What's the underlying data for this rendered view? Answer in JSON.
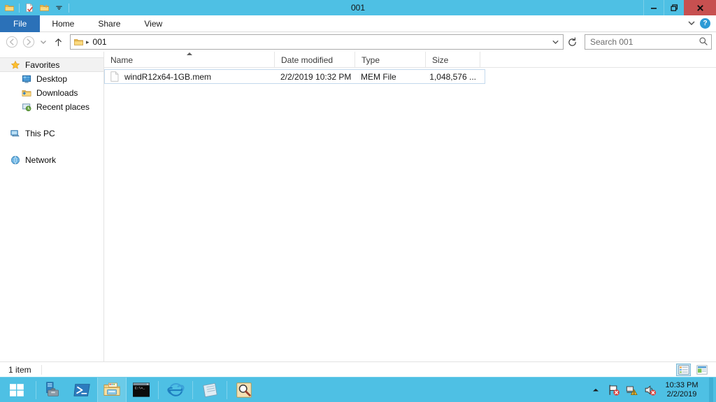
{
  "window": {
    "title": "001",
    "quick_access": [
      {
        "name": "system-menu-folder-icon",
        "label": "001"
      },
      {
        "name": "properties-icon",
        "label": "Properties"
      },
      {
        "name": "new-folder-icon",
        "label": "New folder"
      },
      {
        "name": "customize-qat-chevron-icon",
        "label": "Customize Quick Access Toolbar"
      }
    ],
    "controls": {
      "minimize": "Minimize",
      "restore": "Restore Down",
      "close": "Close"
    }
  },
  "ribbon": {
    "tabs": [
      {
        "label": "File",
        "active": true
      },
      {
        "label": "Home",
        "active": false
      },
      {
        "label": "Share",
        "active": false
      },
      {
        "label": "View",
        "active": false
      }
    ],
    "expand_label": "Expand the Ribbon",
    "help_label": "?"
  },
  "navbar": {
    "back_label": "Back",
    "forward_label": "Forward",
    "recent_label": "Recent locations",
    "up_label": "Up",
    "address": {
      "folder_icon": "folder-icon",
      "crumb": "001",
      "separator": "▸",
      "dropdown_label": "Previous locations",
      "refresh_label": "Refresh \"001\" (F5)"
    },
    "search": {
      "placeholder": "Search 001",
      "icon": "search-icon"
    }
  },
  "navpane": {
    "items": [
      {
        "label": "Favorites",
        "icon": "star-icon",
        "level": 0,
        "selected": true
      },
      {
        "label": "Desktop",
        "icon": "desktop-icon",
        "level": 1,
        "selected": false
      },
      {
        "label": "Downloads",
        "icon": "downloads-icon",
        "level": 1,
        "selected": false
      },
      {
        "label": "Recent places",
        "icon": "recent-places-icon",
        "level": 1,
        "selected": false
      },
      {
        "label": "This PC",
        "icon": "this-pc-icon",
        "level": 0,
        "selected": false
      },
      {
        "label": "Network",
        "icon": "network-icon",
        "level": 0,
        "selected": false
      }
    ]
  },
  "filelist": {
    "columns": [
      {
        "label": "Name",
        "sorted": true,
        "sort_direction": "asc"
      },
      {
        "label": "Date modified",
        "sorted": false
      },
      {
        "label": "Type",
        "sorted": false
      },
      {
        "label": "Size",
        "sorted": false
      }
    ],
    "rows": [
      {
        "icon": "generic-file-icon",
        "name": "windR12x64-1GB.mem",
        "date_modified": "2/2/2019 10:32 PM",
        "type": "MEM File",
        "size": "1,048,576 ..."
      }
    ]
  },
  "statusbar": {
    "item_count": "1 item",
    "views": [
      {
        "name": "details-view-button",
        "label": "Details",
        "active": true
      },
      {
        "name": "large-icons-view-button",
        "label": "Large icons",
        "active": false
      }
    ]
  },
  "taskbar": {
    "start_label": "Start",
    "items": [
      {
        "name": "taskbar-server-manager",
        "label": "Server Manager",
        "active": false
      },
      {
        "name": "taskbar-powershell",
        "label": "Windows PowerShell",
        "active": false
      },
      {
        "name": "taskbar-file-explorer",
        "label": "File Explorer",
        "active": true
      },
      {
        "name": "taskbar-command-prompt",
        "label": "Command Prompt",
        "active": false
      },
      {
        "name": "taskbar-internet-explorer",
        "label": "Internet Explorer",
        "active": false
      },
      {
        "name": "taskbar-notepad",
        "label": "Notepad",
        "active": false
      },
      {
        "name": "taskbar-search",
        "label": "Search",
        "active": false
      }
    ],
    "tray": {
      "show_hidden_label": "Show hidden icons",
      "action_center_label": "Action Center",
      "network_label": "Network",
      "volume_label": "Volume",
      "time": "10:33 PM",
      "date": "2/2/2019"
    }
  },
  "colors": {
    "titlebar": "#4EC0E4",
    "file_tab": "#2B71B8",
    "close_button": "#C75050",
    "taskbar": "#4EC0E4",
    "selection": "#CCE8F4",
    "row_border": "#C3D9ED"
  }
}
